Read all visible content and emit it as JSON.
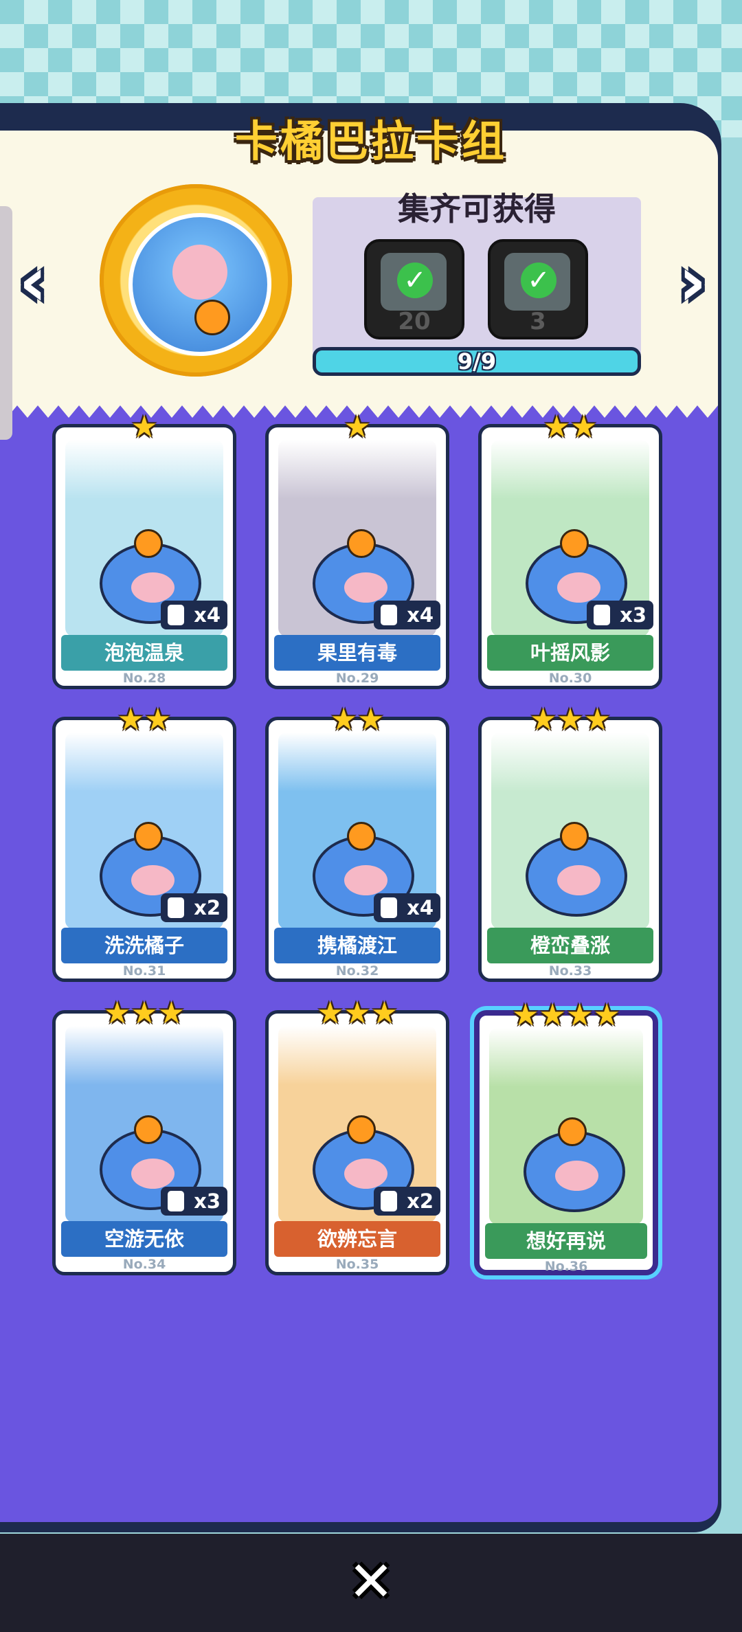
{
  "title": "卡橘巴拉卡组",
  "rewards": {
    "heading": "集齐可获得",
    "items": [
      {
        "count": "20",
        "icon": "check-icon"
      },
      {
        "count": "3",
        "icon": "check-icon"
      }
    ],
    "progress_text": "9/9",
    "progress_fraction": 1.0
  },
  "nav": {
    "prev": "‹",
    "next": "›"
  },
  "cards": [
    {
      "name": "泡泡温泉",
      "no": "No.28",
      "stars": "★",
      "count": "x4",
      "ribbon": "#3aa0a8",
      "bg": "#b9e3f0"
    },
    {
      "name": "果里有毒",
      "no": "No.29",
      "stars": "★",
      "count": "x4",
      "ribbon": "#2c6fc4",
      "bg": "#c9c4d4"
    },
    {
      "name": "叶摇风影",
      "no": "No.30",
      "stars": "★★",
      "count": "x3",
      "ribbon": "#3a9a5a",
      "bg": "#bfe7c3"
    },
    {
      "name": "洗洗橘子",
      "no": "No.31",
      "stars": "★★",
      "count": "x2",
      "ribbon": "#2c6fc4",
      "bg": "#9fd0f5"
    },
    {
      "name": "携橘渡江",
      "no": "No.32",
      "stars": "★★",
      "count": "x4",
      "ribbon": "#2c6fc4",
      "bg": "#7ec0ef"
    },
    {
      "name": "橙峦叠涨",
      "no": "No.33",
      "stars": "★★★",
      "count": "",
      "ribbon": "#3a9a5a",
      "bg": "#c7ead0"
    },
    {
      "name": "空游无依",
      "no": "No.34",
      "stars": "★★★",
      "count": "x3",
      "ribbon": "#2c6fc4",
      "bg": "#7fb6ee"
    },
    {
      "name": "欲辨忘言",
      "no": "No.35",
      "stars": "★★★",
      "count": "x2",
      "ribbon": "#d8612f",
      "bg": "#f7d29a"
    },
    {
      "name": "想好再说",
      "no": "No.36",
      "stars": "★★★★",
      "count": "",
      "ribbon": "#3a9a5a",
      "bg": "#b8e0a8"
    }
  ],
  "close_label": "✕"
}
